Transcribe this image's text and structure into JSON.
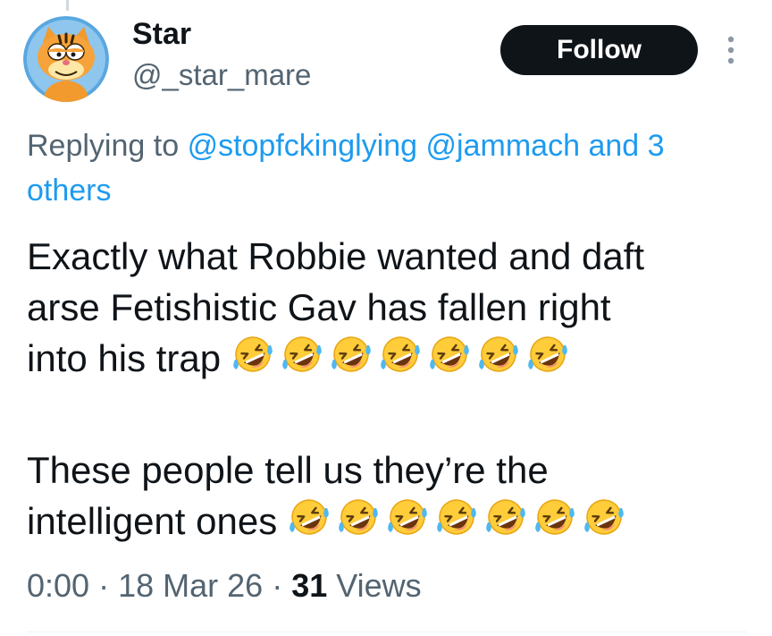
{
  "author": {
    "display_name": "Star",
    "handle": "@_star_mare",
    "avatar_icon": "garfield-avatar-icon"
  },
  "follow_label": "Follow",
  "more_icon": "more-vertical-icon",
  "reply": {
    "prefix": "Replying to",
    "mentions": [
      "@stopfckinglying",
      "@jammach"
    ],
    "suffix": "and 3",
    "others": "others"
  },
  "tweet": {
    "line1": "Exactly what Robbie wanted and daft",
    "line2": "arse Fetishistic Gav has fallen right",
    "line3": "into his trap",
    "line3_emoji_count": 7,
    "line4": "These people tell us they’re the",
    "line5": "intelligent ones",
    "line5_emoji_count": 7,
    "emoji": "rolling-on-the-floor-laughing-emoji"
  },
  "meta": {
    "time": "0:00",
    "sep": "·",
    "date": "18 Mar 26",
    "views_count": "31",
    "views_label": "Views"
  },
  "colors": {
    "link": "#1d9bf0",
    "secondary_text": "#536471",
    "primary_text": "#0f1419",
    "button_bg": "#0f1419"
  }
}
